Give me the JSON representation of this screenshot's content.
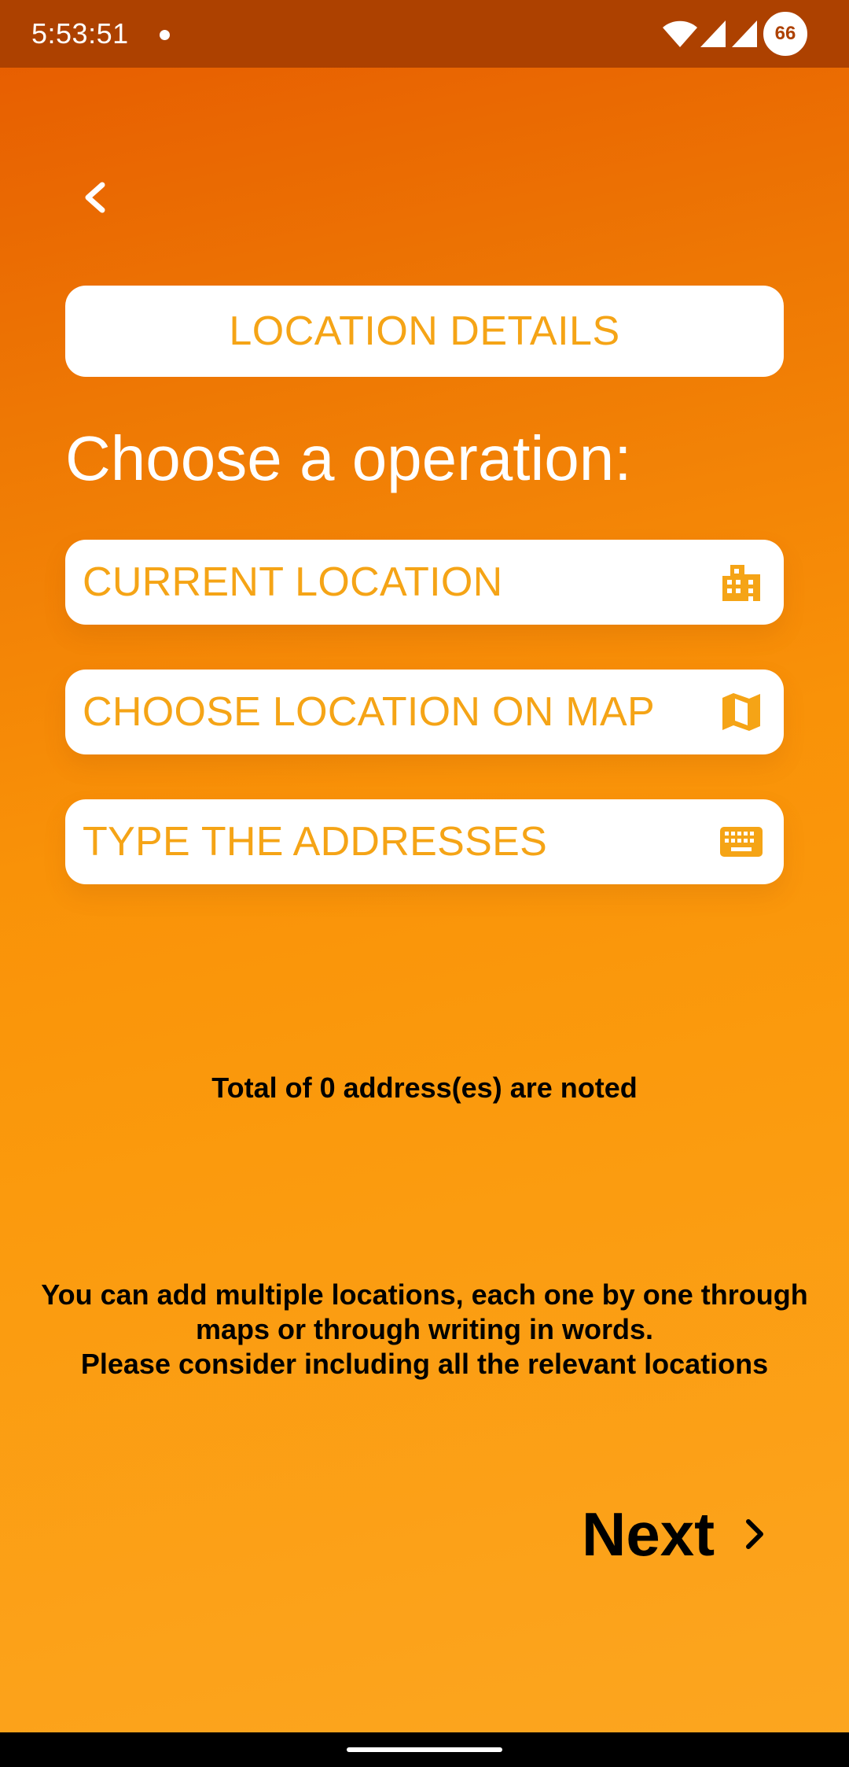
{
  "status_bar": {
    "time": "5:53:51",
    "battery_level": "66",
    "icons": [
      "notification-dot-icon",
      "wifi-icon",
      "signal-icon",
      "signal-icon",
      "battery-icon"
    ]
  },
  "header": {
    "back_icon": "chevron-left-icon",
    "title": "LOCATION DETAILS"
  },
  "main": {
    "heading": "Choose a operation:",
    "operations": [
      {
        "label": "CURRENT LOCATION",
        "icon": "building-icon"
      },
      {
        "label": "CHOOSE LOCATION ON MAP",
        "icon": "map-icon"
      },
      {
        "label": "TYPE THE ADDRESSES",
        "icon": "keyboard-icon"
      }
    ],
    "total_text": "Total of 0 address(es) are noted",
    "info_lines": [
      "You can add multiple locations, each one by one through",
      "maps or through writing in words.",
      "Please consider including all the relevant locations"
    ]
  },
  "footer": {
    "next_label": "Next",
    "next_icon": "chevron-right-icon"
  },
  "colors": {
    "accent_text": "#F5A416",
    "status_bar": "#AD4100",
    "gradient_top": "#E65A00",
    "gradient_bottom": "#FCA620"
  }
}
